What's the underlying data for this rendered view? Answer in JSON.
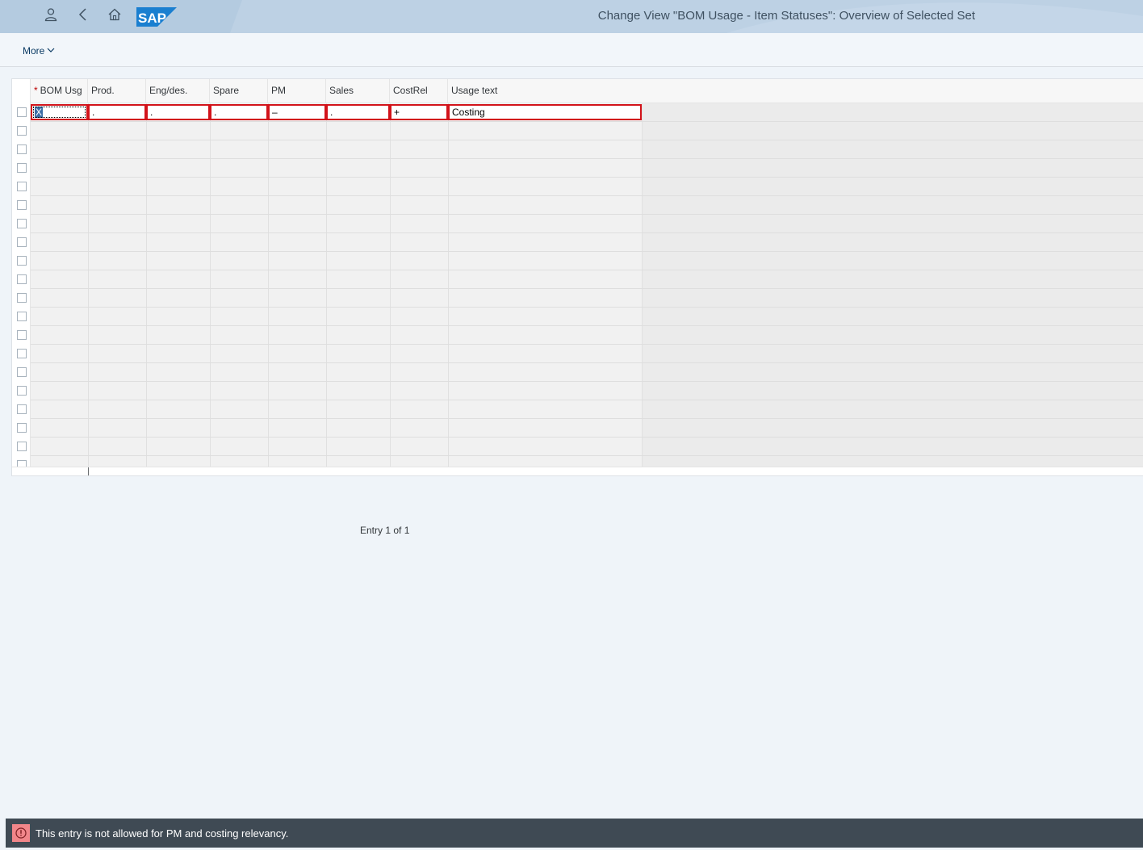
{
  "shell": {
    "title": "Change View \"BOM Usage - Item Statuses\": Overview of Selected Set",
    "logo_text": "SAP",
    "buttons": [
      "user-icon",
      "back-icon",
      "home-icon"
    ]
  },
  "toolbar": {
    "more_label": "More"
  },
  "table": {
    "columns": [
      {
        "label": "BOM Usg",
        "required": true
      },
      {
        "label": "Prod.",
        "required": false
      },
      {
        "label": "Eng/des.",
        "required": false
      },
      {
        "label": "Spare",
        "required": false
      },
      {
        "label": "PM",
        "required": false
      },
      {
        "label": "Sales",
        "required": false
      },
      {
        "label": "CostRel",
        "required": false
      },
      {
        "label": "Usage text",
        "required": false
      }
    ],
    "rows": [
      {
        "values": [
          "X",
          ".",
          ".",
          ".",
          "–",
          ".",
          "+",
          "Costing"
        ]
      }
    ],
    "empty_row_count": 19,
    "required_marker": "*"
  },
  "footer": {
    "entry_count": "Entry 1 of 1"
  },
  "message": {
    "type": "error",
    "icon": "error-icon",
    "text": "This entry is not allowed for PM and costing relevancy."
  },
  "colors": {
    "shell_bg": "#b4cbe0",
    "error_border": "#d2131a",
    "message_bg": "#3f4a54",
    "error_icon_bg": "#f1868a"
  }
}
